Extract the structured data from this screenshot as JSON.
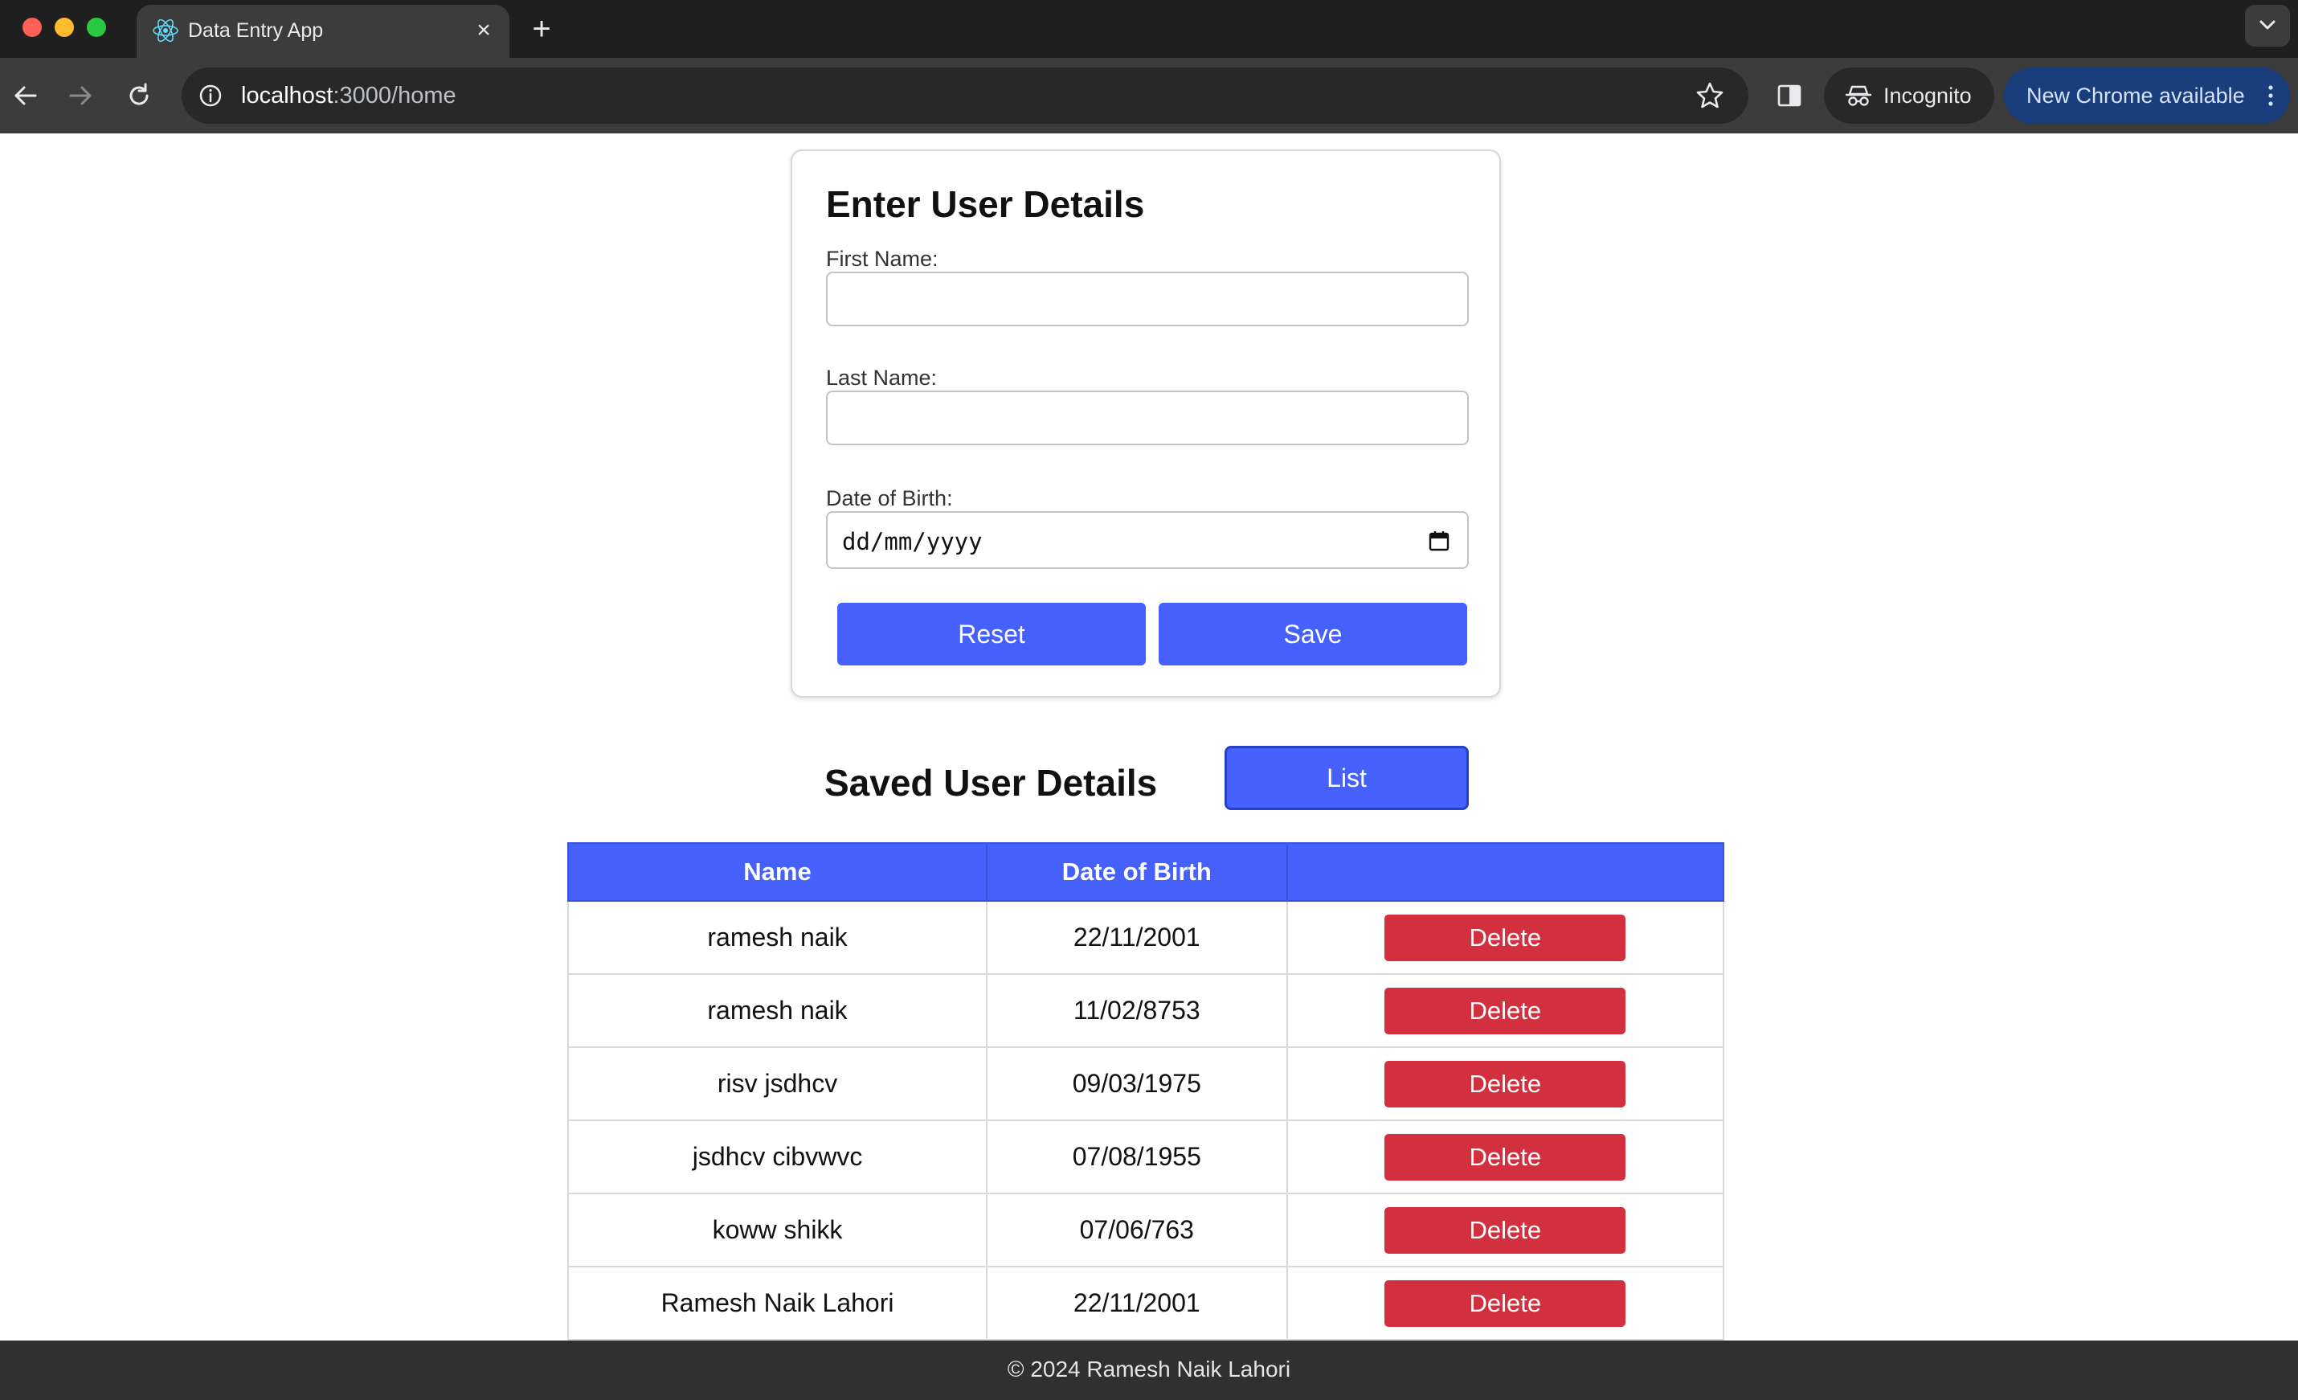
{
  "browser": {
    "tab_title": "Data Entry App",
    "new_tab_label": "+",
    "close_tab_label": "×",
    "url_host": "localhost",
    "url_path": ":3000/home",
    "incognito_label": "Incognito",
    "update_label": "New Chrome available"
  },
  "form": {
    "title": "Enter User Details",
    "first_name_label": "First Name:",
    "first_name_value": "",
    "last_name_label": "Last Name:",
    "last_name_value": "",
    "dob_label": "Date of Birth:",
    "dob_placeholder": "dd/mm/yyyy",
    "reset_label": "Reset",
    "save_label": "Save"
  },
  "saved": {
    "title": "Saved User Details",
    "list_label": "List",
    "columns": [
      "Name",
      "Date of Birth",
      ""
    ],
    "delete_label": "Delete",
    "rows": [
      {
        "name": "ramesh naik",
        "dob": "22/11/2001"
      },
      {
        "name": "ramesh naik",
        "dob": "11/02/8753"
      },
      {
        "name": "risv jsdhcv",
        "dob": "09/03/1975"
      },
      {
        "name": "jsdhcv cibvwvc",
        "dob": "07/08/1955"
      },
      {
        "name": "koww shikk",
        "dob": "07/06/763"
      },
      {
        "name": "Ramesh Naik Lahori",
        "dob": "22/11/2001"
      }
    ]
  },
  "footer": {
    "text": "© 2024 Ramesh Naik Lahori"
  },
  "colors": {
    "primary": "#4660fc",
    "danger": "#d2303f",
    "footer_bg": "#303030"
  }
}
